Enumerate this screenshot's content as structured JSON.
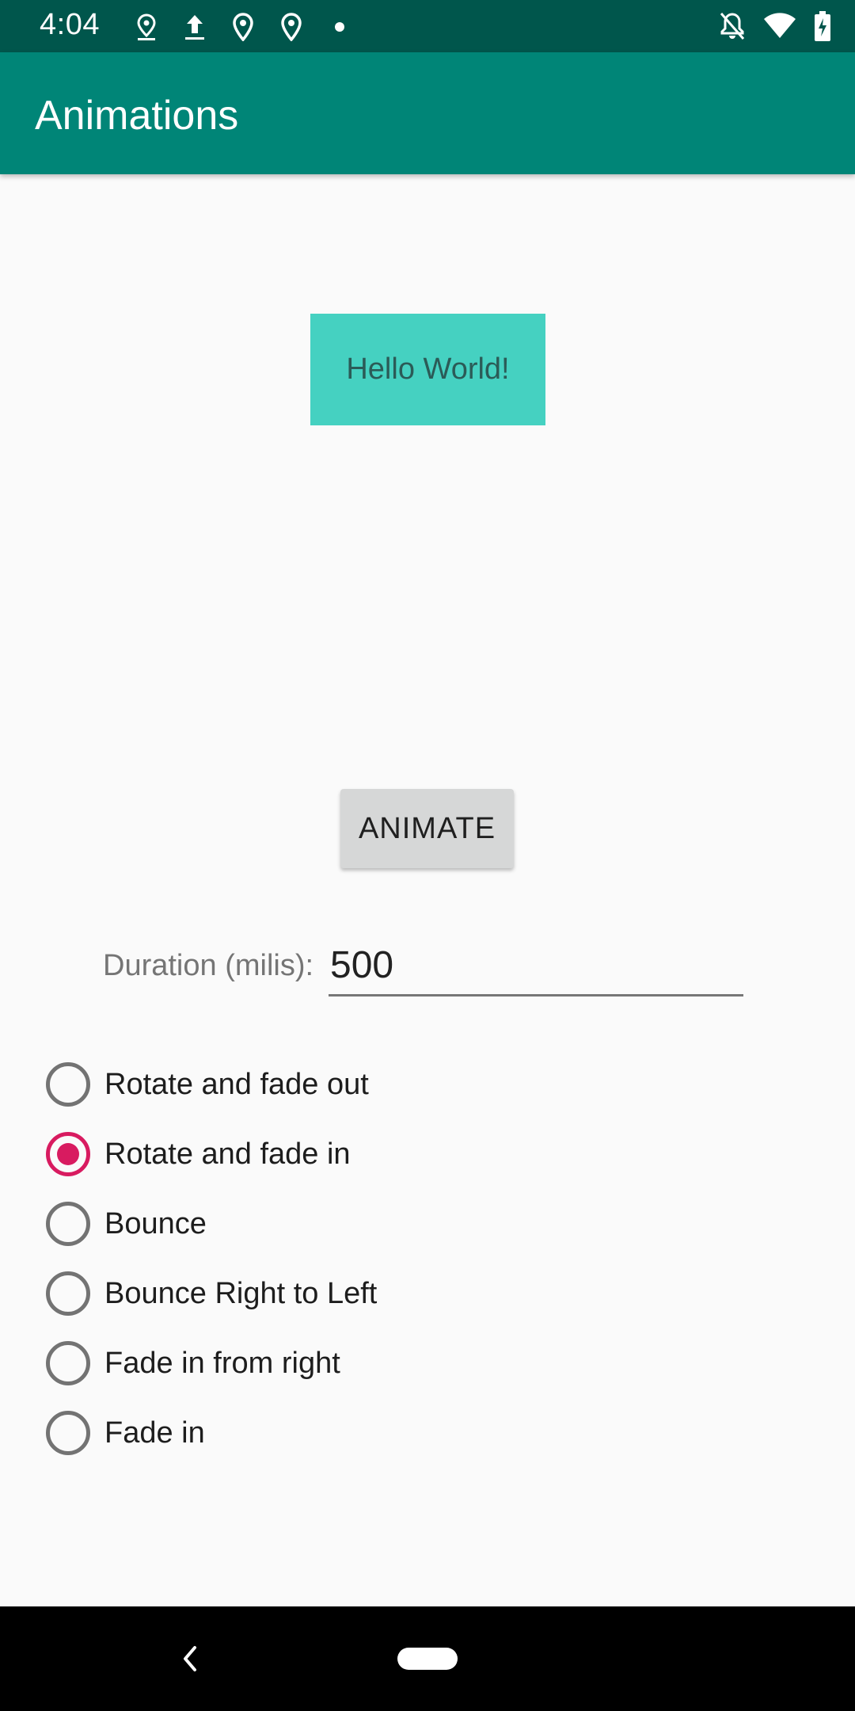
{
  "status_bar": {
    "time": "4:04",
    "left_icons": [
      "location-pin-icon",
      "upload-icon",
      "map-pin-icon",
      "map-pin-icon",
      "dot-icon"
    ],
    "right_icons": [
      "notifications-off-icon",
      "wifi-icon",
      "battery-icon"
    ]
  },
  "app_bar": {
    "title": "Animations",
    "color": "#008577"
  },
  "preview": {
    "text": "Hello World!",
    "color": "#45d1c1"
  },
  "animate_button": {
    "label": "ANIMATE"
  },
  "duration": {
    "label": "Duration (milis):",
    "value": "500"
  },
  "radio_options": [
    {
      "label": "Rotate and fade out",
      "checked": false
    },
    {
      "label": "Rotate and fade in",
      "checked": true
    },
    {
      "label": "Bounce",
      "checked": false
    },
    {
      "label": "Bounce Right to Left",
      "checked": false
    },
    {
      "label": "Fade in from right",
      "checked": false
    },
    {
      "label": "Fade in",
      "checked": false
    }
  ],
  "accent_color": "#d81b60",
  "nav_bar": {
    "icons": [
      "back-icon",
      "home-pill-icon"
    ]
  }
}
